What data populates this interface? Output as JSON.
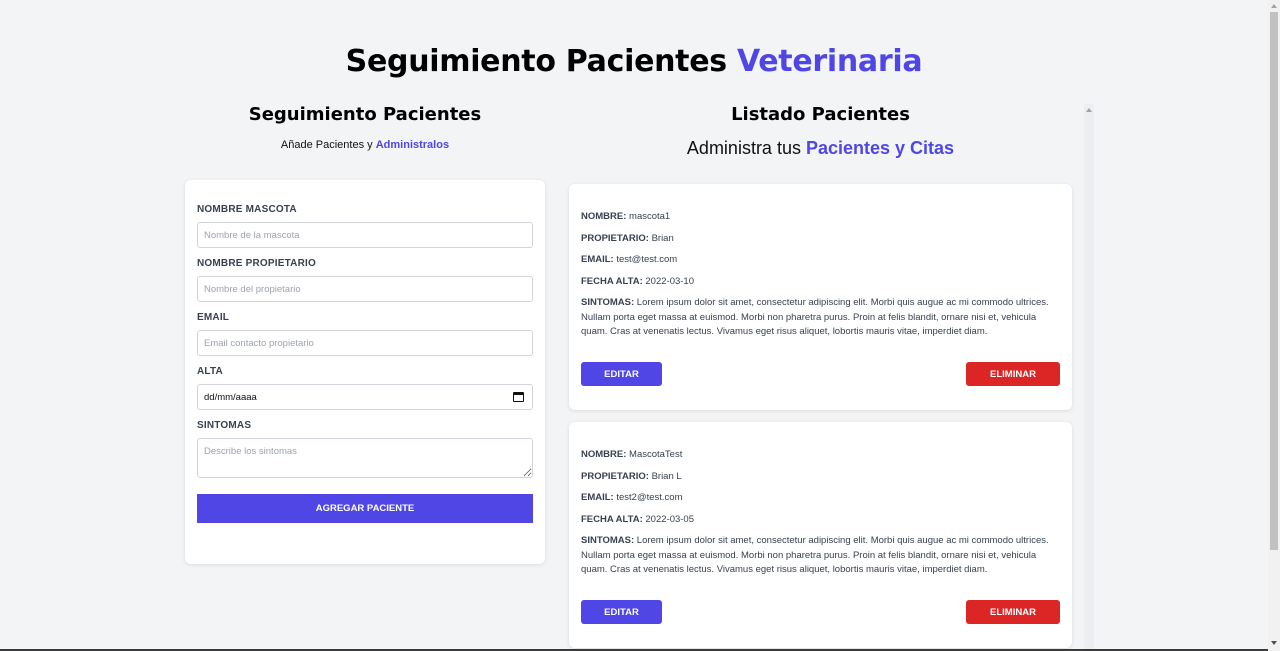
{
  "header": {
    "title_main": "Seguimiento Pacientes",
    "title_accent": "Veterinaria"
  },
  "form_section": {
    "title": "Seguimiento Pacientes",
    "subtitle_plain": "Añade Pacientes y",
    "subtitle_accent": "Administralos",
    "fields": {
      "pet_name": {
        "label": "Nombre Mascota",
        "placeholder": "Nombre de la mascota",
        "value": ""
      },
      "owner_name": {
        "label": "Nombre Propietario",
        "placeholder": "Nombre del propietario",
        "value": ""
      },
      "email": {
        "label": "Email",
        "placeholder": "Email contacto propietario",
        "value": ""
      },
      "date": {
        "label": "Alta",
        "display": "dd/mm/aaaa",
        "icon": "calendar-icon"
      },
      "symptoms": {
        "label": "Sintomas",
        "placeholder": "Describe los sintomas",
        "value": ""
      }
    },
    "submit_label": "Agregar Paciente"
  },
  "list_section": {
    "title": "Listado Pacientes",
    "subtitle_plain": "Administra tus",
    "subtitle_accent": "Pacientes y Citas",
    "labels": {
      "name": "Nombre:",
      "owner": "Propietario:",
      "email": "Email:",
      "date": "Fecha Alta:",
      "symptoms": "Sintomas:"
    },
    "edit_label": "Editar",
    "delete_label": "Eliminar",
    "patients": [
      {
        "name": "mascota1",
        "owner": "Brian",
        "email": "test@test.com",
        "date": "2022-03-10",
        "symptoms": "Lorem ipsum dolor sit amet, consectetur adipiscing elit. Morbi quis augue ac mi commodo ultrices. Nullam porta eget massa at euismod. Morbi non pharetra purus. Proin at felis blandit, ornare nisi et, vehicula quam. Cras at venenatis lectus. Vivamus eget risus aliquet, lobortis mauris vitae, imperdiet diam."
      },
      {
        "name": "MascotaTest",
        "owner": "Brian L",
        "email": "test2@test.com",
        "date": "2022-03-05",
        "symptoms": "Lorem ipsum dolor sit amet, consectetur adipiscing elit. Morbi quis augue ac mi commodo ultrices. Nullam porta eget massa at euismod. Morbi non pharetra purus. Proin at felis blandit, ornare nisi et, vehicula quam. Cras at venenatis lectus. Vivamus eget risus aliquet, lobortis mauris vitae, imperdiet diam."
      }
    ]
  },
  "colors": {
    "accent": "#4f46e5",
    "danger": "#dc2626",
    "background": "#f3f4f6"
  }
}
